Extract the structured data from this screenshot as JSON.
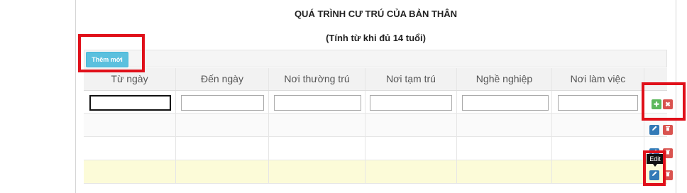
{
  "page": {
    "title": "QUÁ TRÌNH CƯ TRÚ CỦA BẢN THÂN",
    "subtitle": "(Tính từ khi đủ 14 tuổi)"
  },
  "toolbar": {
    "add_label": "Thêm mới"
  },
  "table": {
    "columns": [
      "Từ ngày",
      "Đến ngày",
      "Nơi thường trú",
      "Nơi tạm trú",
      "Nghề nghiệp",
      "Nơi làm việc"
    ],
    "edit_row": {
      "values": [
        "",
        "",
        "",
        "",
        "",
        ""
      ]
    },
    "rows": [
      {
        "values": [
          "",
          "",
          "",
          "",
          "",
          ""
        ]
      },
      {
        "values": [
          "",
          "",
          "",
          "",
          "",
          ""
        ]
      },
      {
        "values": [
          "",
          "",
          "",
          "",
          "",
          ""
        ]
      }
    ]
  },
  "tooltip": {
    "text": "Edit"
  },
  "icons": {
    "save": "plus-icon",
    "cancel": "x-icon",
    "edit": "pencil-icon",
    "delete": "trash-icon"
  },
  "colors": {
    "add_button": "#5bc0de",
    "save": "#5cb85c",
    "cancel": "#d9534f",
    "edit": "#337ab7",
    "delete": "#d9534f",
    "selected_row": "#fcfbd8",
    "highlight": "#e0101a"
  }
}
